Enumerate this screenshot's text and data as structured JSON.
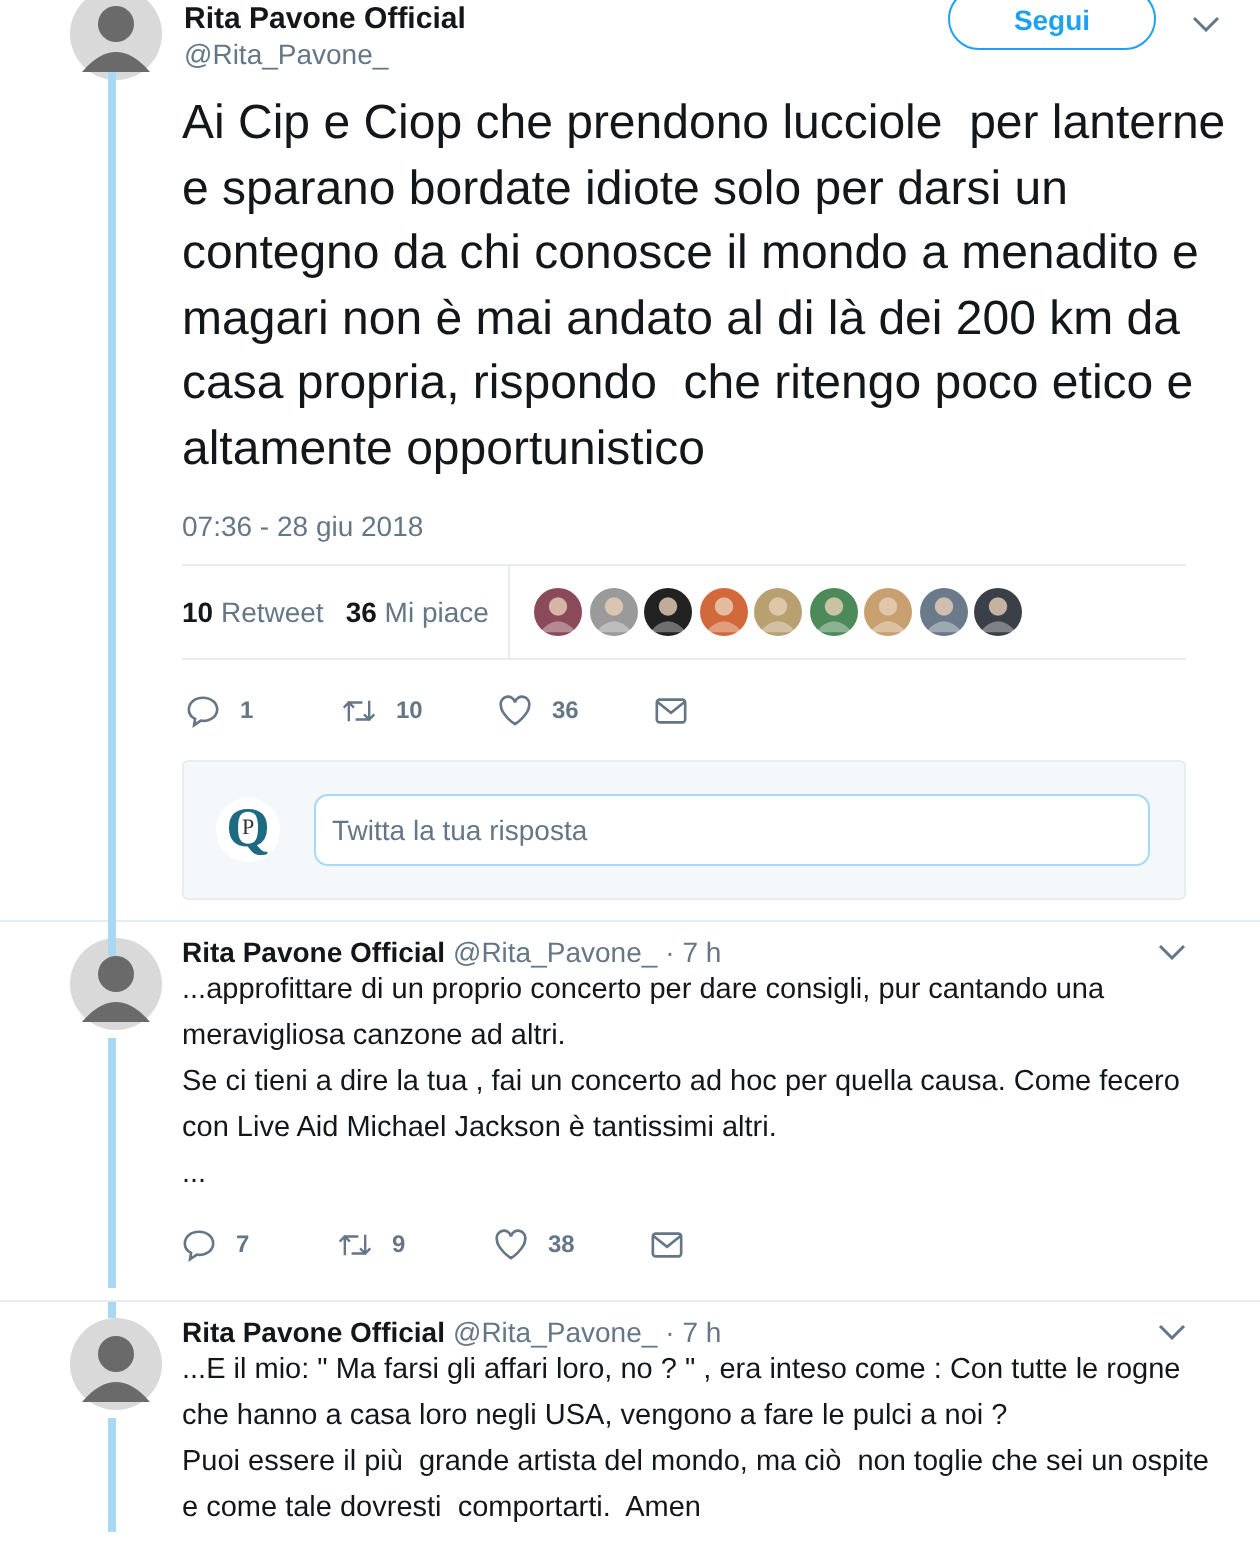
{
  "tweet": {
    "author": "Rita Pavone Official",
    "handle": "@Rita_Pavone_",
    "follow_button": "Segui",
    "text": "Ai Cip e Ciop che prendono lucciole  per lanterne e sparano bordate idiote solo per darsi un contegno da chi conosce il mondo a menadito e  magari non è mai andato al di là dei 200 km da casa propria, rispondo  che ritengo poco etico e altamente opportunistico",
    "timestamp": "07:36 - 28 giu 2018",
    "stats": [
      {
        "count": "10",
        "label": "Retweet"
      },
      {
        "count": "36",
        "label": "Mi piace"
      }
    ],
    "actions": [
      {
        "kind": "reply",
        "count": "1"
      },
      {
        "kind": "retweet",
        "count": "10"
      },
      {
        "kind": "like",
        "count": "36"
      },
      {
        "kind": "message"
      }
    ]
  },
  "reply_box": {
    "logo": {
      "outer": "Q",
      "inner": "P"
    },
    "placeholder": "Twitta la tua risposta"
  },
  "replies": [
    {
      "author": "Rita Pavone Official",
      "handle": "@Rita_Pavone_",
      "time": "· 7 h",
      "paragraphs": [
        "...approfittare di un proprio concerto per dare consigli, pur cantando una meravigliosa canzone ad altri.",
        "Se ci tieni a dire la tua , fai un concerto ad hoc per quella causa. Come fecero con Live Aid Michael Jackson è tantissimi altri.",
        "..."
      ],
      "actions": [
        {
          "kind": "reply",
          "count": "7"
        },
        {
          "kind": "retweet",
          "count": "9"
        },
        {
          "kind": "like",
          "count": "38"
        },
        {
          "kind": "message"
        }
      ]
    },
    {
      "author": "Rita Pavone Official",
      "handle": "@Rita_Pavone_",
      "time": "· 7 h",
      "paragraphs": [
        "...E il mio: \" Ma farsi gli affari loro, no ? \" , era inteso come : Con tutte le rogne che hanno a casa loro negli USA, vengono a fare le pulci a noi ?",
        "Puoi essere il più  grande artista del mondo, ma ciò  non toglie che sei un ospite e come tale dovresti  comportarti.  Amen"
      ]
    }
  ]
}
